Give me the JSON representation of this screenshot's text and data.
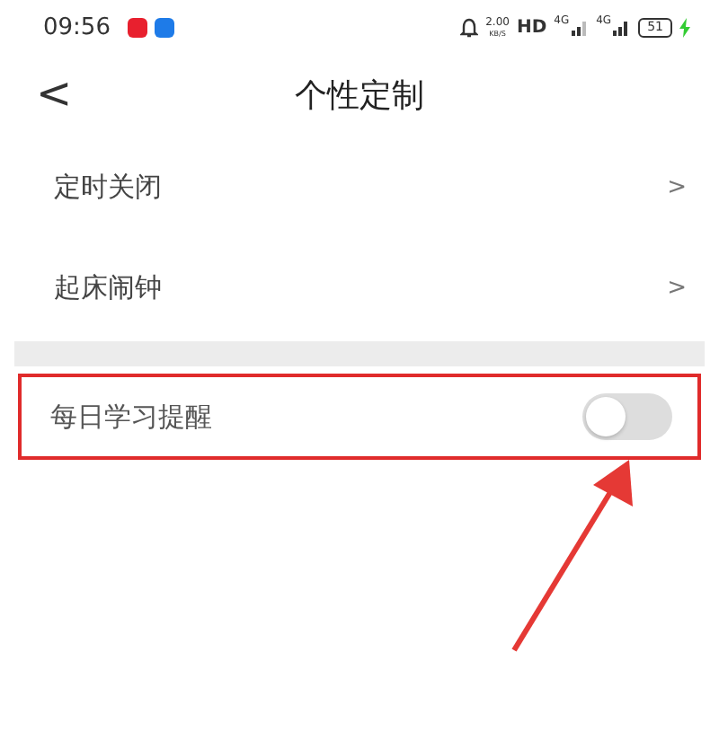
{
  "status_bar": {
    "time": "09:56",
    "speed": "2.00",
    "speed_unit": "KB/S",
    "network": "HD",
    "signals": [
      "4G",
      "4G"
    ],
    "battery": "51"
  },
  "header": {
    "back": "<",
    "title": "个性定制"
  },
  "menu_items": [
    {
      "label": "定时关闭",
      "chevron": ">"
    },
    {
      "label": "起床闹钟",
      "chevron": ">"
    }
  ],
  "reminder": {
    "label": "每日学习提醒",
    "on": false,
    "highlighted": true
  }
}
